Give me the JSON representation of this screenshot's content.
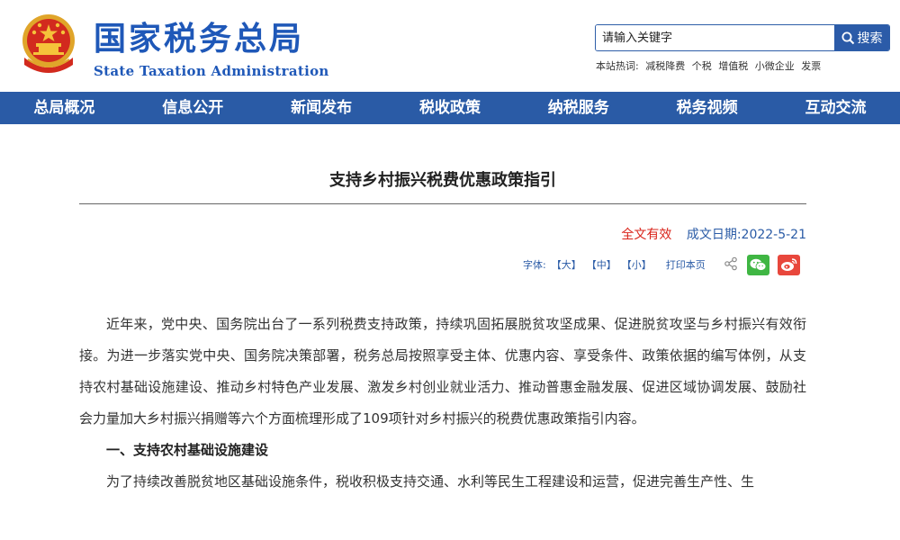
{
  "header": {
    "logo_cn": "国家税务总局",
    "logo_en": "State Taxation Administration",
    "emblem_icon": "national-emblem-icon",
    "search": {
      "placeholder": "请输入关键字",
      "button_label": "搜索"
    },
    "hot_label": "本站热词:",
    "hot_terms": [
      "减税降费",
      "个税",
      "增值税",
      "小微企业",
      "发票"
    ]
  },
  "nav": {
    "items": [
      "总局概况",
      "信息公开",
      "新闻发布",
      "税收政策",
      "纳税服务",
      "税务视频",
      "互动交流"
    ]
  },
  "article": {
    "title": "支持乡村振兴税费优惠政策指引",
    "status": "全文有效",
    "date": "成文日期:2022-5-21",
    "tools": {
      "font_label": "字体:",
      "font_large": "【大】",
      "font_medium": "【中】",
      "font_small": "【小】",
      "print": "打印本页"
    },
    "paragraphs": [
      "近年来，党中央、国务院出台了一系列税费支持政策，持续巩固拓展脱贫攻坚成果、促进脱贫攻坚与乡村振兴有效衔接。为进一步落实党中央、国务院决策部署，税务总局按照享受主体、优惠内容、享受条件、政策依据的编写体例，从支持农村基础设施建设、推动乡村特色产业发展、激发乡村创业就业活力、推动普惠金融发展、促进区域协调发展、鼓励社会力量加大乡村振兴捐赠等六个方面梳理形成了109项针对乡村振兴的税费优惠政策指引内容。"
    ],
    "section_heading": "一、支持农村基础设施建设",
    "section_paragraph": "为了持续改善脱贫地区基础设施条件，税收积极支持交通、水利等民生工程建设和运营，促进完善生产性、生"
  },
  "colors": {
    "brand_blue": "#2a5ba6",
    "logo_blue": "#1f58b8",
    "status_red": "#d9231a",
    "wechat_green": "#3fb643",
    "weibo_red": "#e8473c"
  }
}
